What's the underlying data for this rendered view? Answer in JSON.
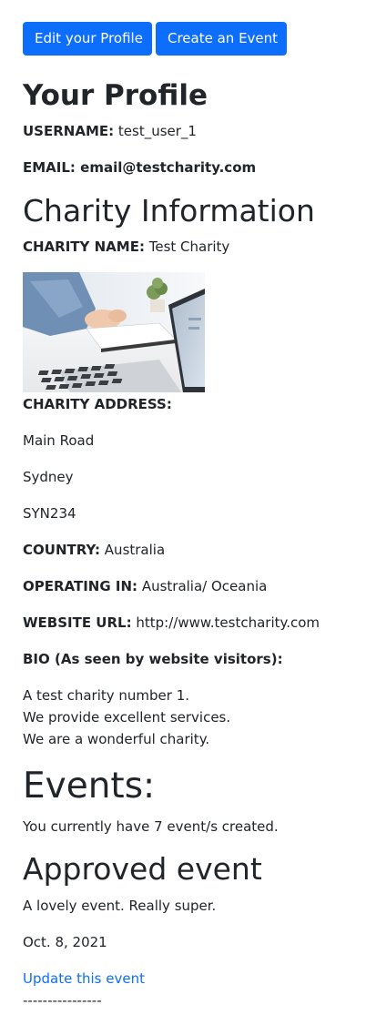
{
  "toolbar": {
    "edit_profile_label": "Edit your Profile",
    "create_event_label": "Create an Event"
  },
  "profile": {
    "heading": "Your Profile",
    "username_label": "USERNAME:",
    "username_value": "test_user_1",
    "email_label": "EMAIL:",
    "email_value": "email@testcharity.com"
  },
  "charity": {
    "heading": "Charity Information",
    "name_label": "CHARITY NAME:",
    "name_value": "Test Charity",
    "photo_desc": "laptop-on-desk-photo",
    "address_label": "CHARITY ADDRESS:",
    "address_line1": "Main Road",
    "address_line2": "Sydney",
    "address_line3": "SYN234",
    "country_label": "COUNTRY:",
    "country_value": "Australia",
    "operating_label": "OPERATING IN:",
    "operating_value": "Australia/ Oceania",
    "website_label": "WEBSITE URL:",
    "website_value": "http://www.testcharity.com",
    "bio_label": "BIO (As seen by website visitors):",
    "bio_line1": "A test charity number 1.",
    "bio_line2": "We provide excellent services.",
    "bio_line3": "We are a wonderful charity."
  },
  "events": {
    "heading": "Events:",
    "summary": "You currently have 7 event/s created.",
    "items": [
      {
        "title": "Approved event",
        "description": "A lovely event. Really super.",
        "date": "Oct. 8, 2021",
        "update_label": "Update this event",
        "separator": "----------------"
      }
    ]
  },
  "colors": {
    "primary": "#0d6efd",
    "text": "#212529"
  }
}
